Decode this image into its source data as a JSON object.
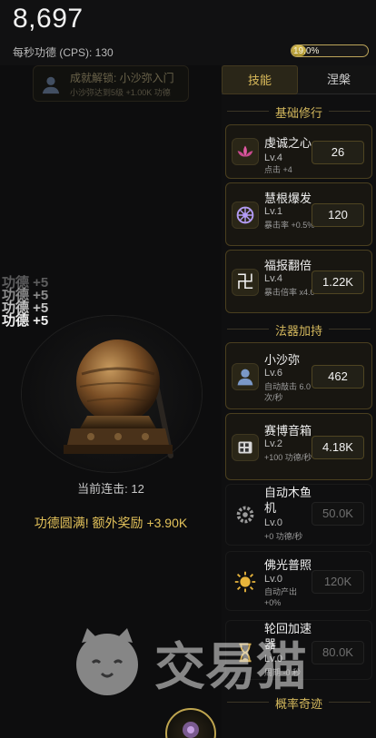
{
  "header": {
    "score": "8,697",
    "cps_label": "每秒功德 (CPS): 130",
    "progress_text": "19.0%",
    "progress_fraction": 0.19
  },
  "achievement": {
    "title": "成就解锁: 小沙弥入门",
    "desc": "小沙弥达到5级 +1.00K 功德"
  },
  "floaters": [
    "功德 +5",
    "功德 +5",
    "功德 +5",
    "功德 +5"
  ],
  "combo": "当前连击: 12",
  "bonus": "功德圆满! 额外奖励 +3.90K",
  "tabs": [
    "技能",
    "涅槃"
  ],
  "sections": {
    "basic": "基础修行",
    "helpers": "法器加持",
    "miracle": "概率奇迹"
  },
  "skills": [
    {
      "name": "虔诚之心",
      "lv": "Lv.4",
      "desc": "点击 +4",
      "cost": "26",
      "icon": "lotus-icon"
    },
    {
      "name": "慧根爆发",
      "lv": "Lv.1",
      "desc": "暴击率 +0.5%",
      "cost": "120",
      "icon": "dharma-wheel-icon"
    },
    {
      "name": "福报翻倍",
      "lv": "Lv.4",
      "desc": "暴击倍率 x4.0",
      "cost": "1.22K",
      "icon": "swastika-icon"
    }
  ],
  "helpers": [
    {
      "name": "小沙弥",
      "lv": "Lv.6",
      "desc": "自动敲击 6.0 次/秒",
      "cost": "462",
      "icon": "monk-icon"
    },
    {
      "name": "赛博音箱",
      "lv": "Lv.2",
      "desc": "+100 功德/秒",
      "cost": "4.18K",
      "icon": "speaker-icon"
    },
    {
      "name": "自动木鱼机",
      "lv": "Lv.0",
      "desc": "+0 功德/秒",
      "cost": "50.0K",
      "icon": "gear-icon"
    },
    {
      "name": "佛光普照",
      "lv": "Lv.0",
      "desc": "自动产出 +0%",
      "cost": "120K",
      "icon": "sun-icon"
    },
    {
      "name": "轮回加速器",
      "lv": "Lv.0",
      "desc": "周期 -0 秒",
      "cost": "80.0K",
      "icon": "hourglass-icon"
    }
  ],
  "watermark": "交易猫",
  "colors": {
    "accent": "#d4b85d",
    "bg": "#0f0f10"
  }
}
